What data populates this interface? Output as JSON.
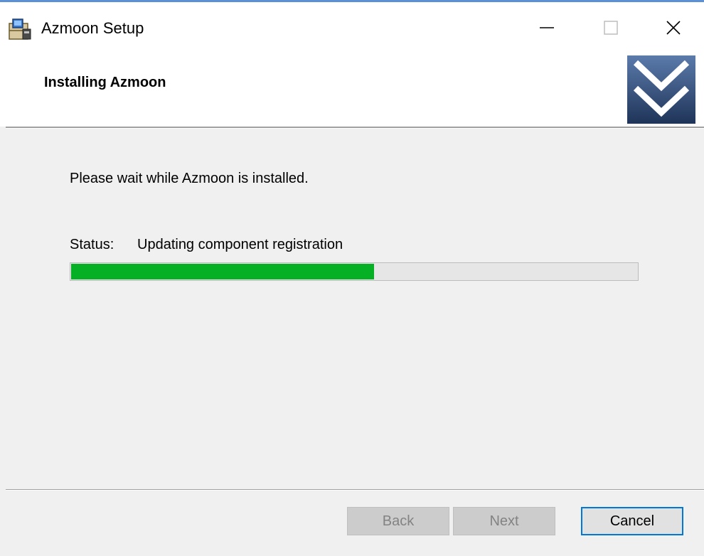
{
  "window": {
    "title": "Azmoon Setup"
  },
  "header": {
    "title": "Installing Azmoon"
  },
  "body": {
    "message": "Please wait while Azmoon is installed.",
    "status_label": "Status:",
    "status_value": "Updating component registration",
    "progress_percent": 53.5
  },
  "footer": {
    "back_label": "Back",
    "next_label": "Next",
    "cancel_label": "Cancel"
  },
  "colors": {
    "progress_fill": "#06b025",
    "focus_border": "#0078d7",
    "banner_dark": "#1f3458",
    "banner_light": "#5b7bab"
  },
  "icons": {
    "app": "installer-package-icon",
    "banner": "double-chevron-down-icon",
    "minimize": "minimize-icon",
    "maximize": "maximize-icon",
    "close": "close-icon"
  }
}
